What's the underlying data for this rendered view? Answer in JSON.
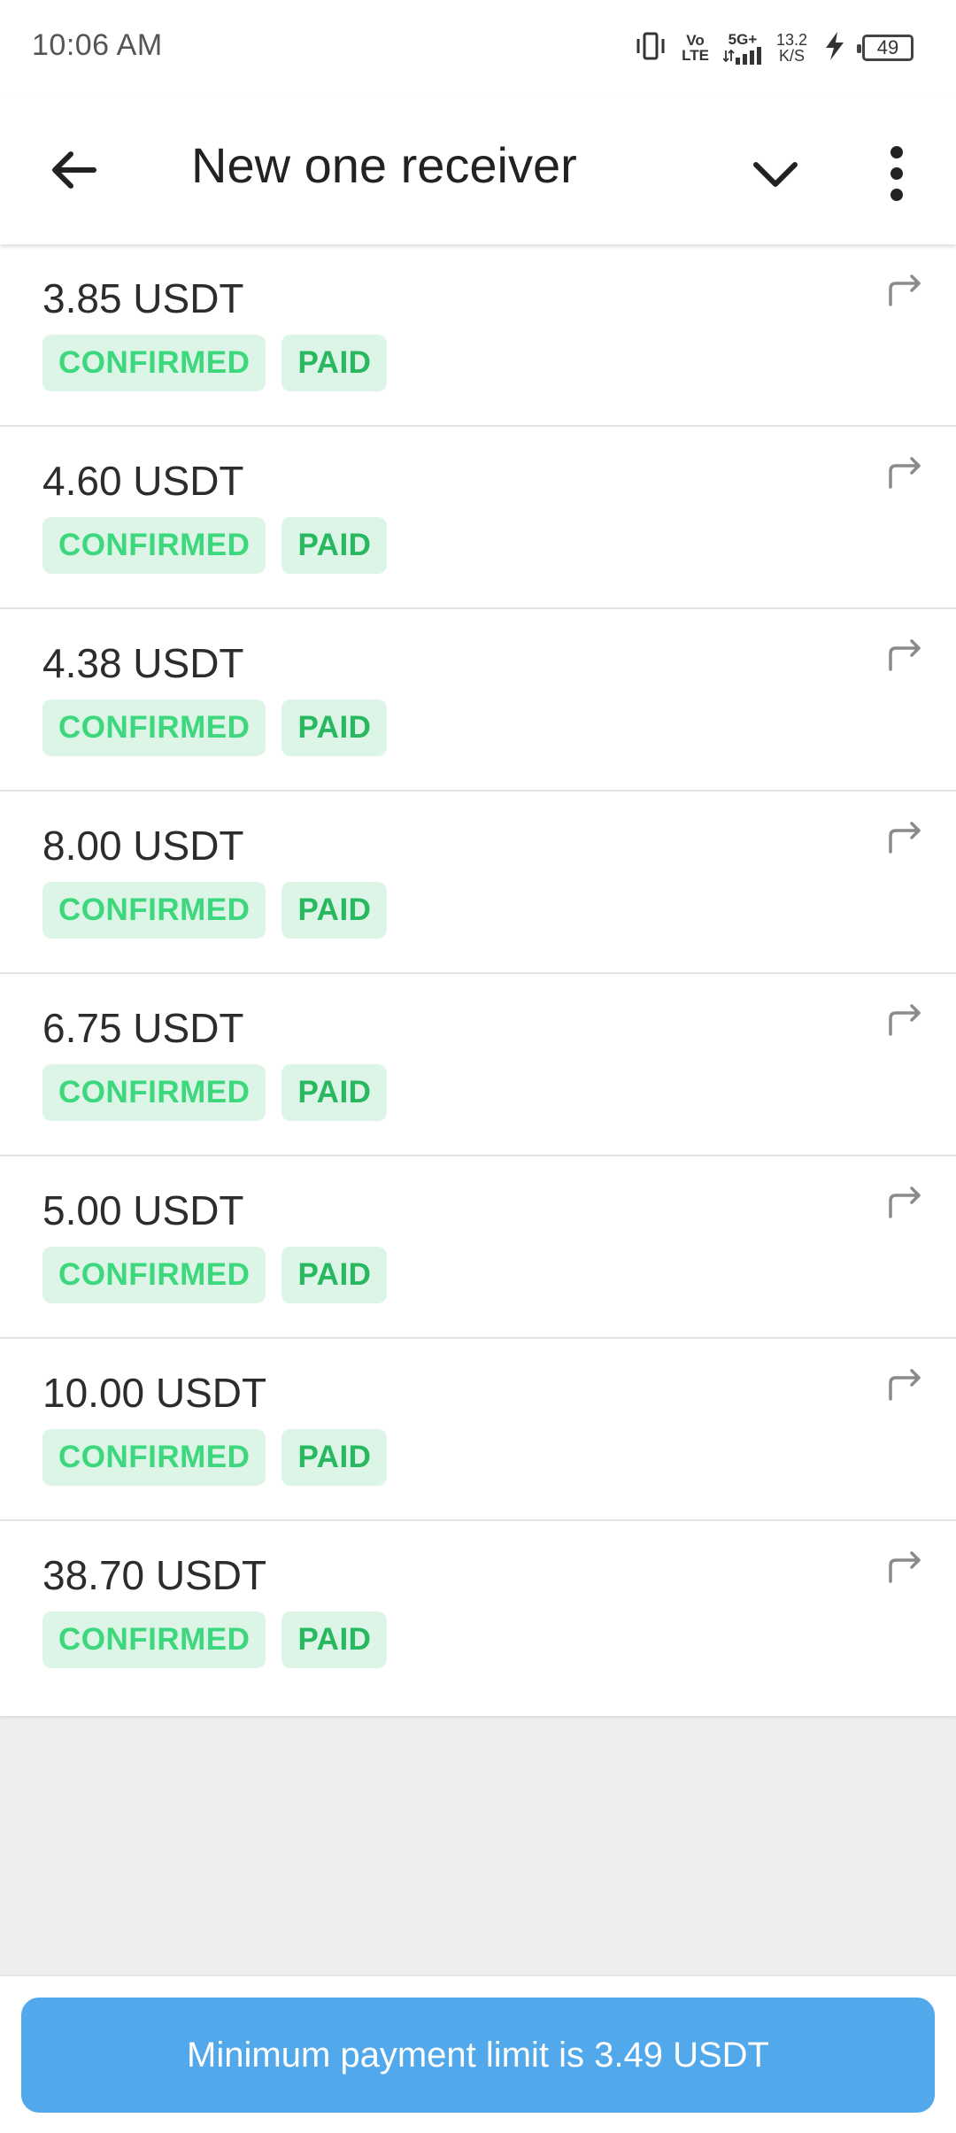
{
  "status_bar": {
    "time": "10:06 AM",
    "volte_top": "Vo",
    "volte_bottom": "LTE",
    "network": "5G+",
    "speed_value": "13.2",
    "speed_unit": "K/S",
    "battery": "49"
  },
  "header": {
    "title": "New one receiver"
  },
  "transactions": [
    {
      "amount": "3.85 USDT",
      "status": "CONFIRMED",
      "payment": "PAID"
    },
    {
      "amount": "4.60 USDT",
      "status": "CONFIRMED",
      "payment": "PAID"
    },
    {
      "amount": "4.38 USDT",
      "status": "CONFIRMED",
      "payment": "PAID"
    },
    {
      "amount": "8.00 USDT",
      "status": "CONFIRMED",
      "payment": "PAID"
    },
    {
      "amount": "6.75 USDT",
      "status": "CONFIRMED",
      "payment": "PAID"
    },
    {
      "amount": "5.00 USDT",
      "status": "CONFIRMED",
      "payment": "PAID"
    },
    {
      "amount": "10.00 USDT",
      "status": "CONFIRMED",
      "payment": "PAID"
    },
    {
      "amount": "38.70 USDT",
      "status": "CONFIRMED",
      "payment": "PAID"
    }
  ],
  "footer": {
    "button_label": "Minimum payment limit is 3.49 USDT"
  },
  "colors": {
    "primary_button": "#51a8ea",
    "badge_bg": "#dcf5e6",
    "confirmed_text": "#3dd77d",
    "paid_text": "#27b860"
  },
  "icons": {
    "back": "arrow-left-icon",
    "dropdown": "chevron-down-icon",
    "more": "more-vert-icon",
    "share": "share-arrow-icon"
  }
}
